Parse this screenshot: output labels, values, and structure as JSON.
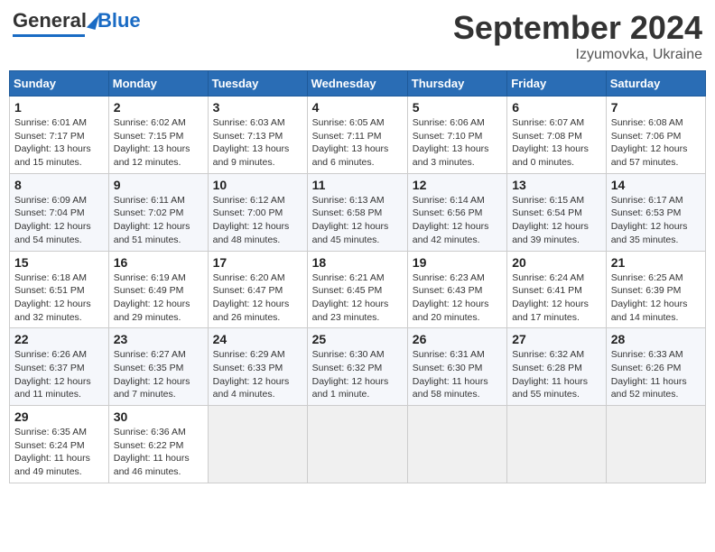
{
  "header": {
    "logo_general": "General",
    "logo_blue": "Blue",
    "month_title": "September 2024",
    "location": "Izyumovka, Ukraine"
  },
  "weekdays": [
    "Sunday",
    "Monday",
    "Tuesday",
    "Wednesday",
    "Thursday",
    "Friday",
    "Saturday"
  ],
  "weeks": [
    [
      {
        "day": "1",
        "info": "Sunrise: 6:01 AM\nSunset: 7:17 PM\nDaylight: 13 hours\nand 15 minutes."
      },
      {
        "day": "2",
        "info": "Sunrise: 6:02 AM\nSunset: 7:15 PM\nDaylight: 13 hours\nand 12 minutes."
      },
      {
        "day": "3",
        "info": "Sunrise: 6:03 AM\nSunset: 7:13 PM\nDaylight: 13 hours\nand 9 minutes."
      },
      {
        "day": "4",
        "info": "Sunrise: 6:05 AM\nSunset: 7:11 PM\nDaylight: 13 hours\nand 6 minutes."
      },
      {
        "day": "5",
        "info": "Sunrise: 6:06 AM\nSunset: 7:10 PM\nDaylight: 13 hours\nand 3 minutes."
      },
      {
        "day": "6",
        "info": "Sunrise: 6:07 AM\nSunset: 7:08 PM\nDaylight: 13 hours\nand 0 minutes."
      },
      {
        "day": "7",
        "info": "Sunrise: 6:08 AM\nSunset: 7:06 PM\nDaylight: 12 hours\nand 57 minutes."
      }
    ],
    [
      {
        "day": "8",
        "info": "Sunrise: 6:09 AM\nSunset: 7:04 PM\nDaylight: 12 hours\nand 54 minutes."
      },
      {
        "day": "9",
        "info": "Sunrise: 6:11 AM\nSunset: 7:02 PM\nDaylight: 12 hours\nand 51 minutes."
      },
      {
        "day": "10",
        "info": "Sunrise: 6:12 AM\nSunset: 7:00 PM\nDaylight: 12 hours\nand 48 minutes."
      },
      {
        "day": "11",
        "info": "Sunrise: 6:13 AM\nSunset: 6:58 PM\nDaylight: 12 hours\nand 45 minutes."
      },
      {
        "day": "12",
        "info": "Sunrise: 6:14 AM\nSunset: 6:56 PM\nDaylight: 12 hours\nand 42 minutes."
      },
      {
        "day": "13",
        "info": "Sunrise: 6:15 AM\nSunset: 6:54 PM\nDaylight: 12 hours\nand 39 minutes."
      },
      {
        "day": "14",
        "info": "Sunrise: 6:17 AM\nSunset: 6:53 PM\nDaylight: 12 hours\nand 35 minutes."
      }
    ],
    [
      {
        "day": "15",
        "info": "Sunrise: 6:18 AM\nSunset: 6:51 PM\nDaylight: 12 hours\nand 32 minutes."
      },
      {
        "day": "16",
        "info": "Sunrise: 6:19 AM\nSunset: 6:49 PM\nDaylight: 12 hours\nand 29 minutes."
      },
      {
        "day": "17",
        "info": "Sunrise: 6:20 AM\nSunset: 6:47 PM\nDaylight: 12 hours\nand 26 minutes."
      },
      {
        "day": "18",
        "info": "Sunrise: 6:21 AM\nSunset: 6:45 PM\nDaylight: 12 hours\nand 23 minutes."
      },
      {
        "day": "19",
        "info": "Sunrise: 6:23 AM\nSunset: 6:43 PM\nDaylight: 12 hours\nand 20 minutes."
      },
      {
        "day": "20",
        "info": "Sunrise: 6:24 AM\nSunset: 6:41 PM\nDaylight: 12 hours\nand 17 minutes."
      },
      {
        "day": "21",
        "info": "Sunrise: 6:25 AM\nSunset: 6:39 PM\nDaylight: 12 hours\nand 14 minutes."
      }
    ],
    [
      {
        "day": "22",
        "info": "Sunrise: 6:26 AM\nSunset: 6:37 PM\nDaylight: 12 hours\nand 11 minutes."
      },
      {
        "day": "23",
        "info": "Sunrise: 6:27 AM\nSunset: 6:35 PM\nDaylight: 12 hours\nand 7 minutes."
      },
      {
        "day": "24",
        "info": "Sunrise: 6:29 AM\nSunset: 6:33 PM\nDaylight: 12 hours\nand 4 minutes."
      },
      {
        "day": "25",
        "info": "Sunrise: 6:30 AM\nSunset: 6:32 PM\nDaylight: 12 hours\nand 1 minute."
      },
      {
        "day": "26",
        "info": "Sunrise: 6:31 AM\nSunset: 6:30 PM\nDaylight: 11 hours\nand 58 minutes."
      },
      {
        "day": "27",
        "info": "Sunrise: 6:32 AM\nSunset: 6:28 PM\nDaylight: 11 hours\nand 55 minutes."
      },
      {
        "day": "28",
        "info": "Sunrise: 6:33 AM\nSunset: 6:26 PM\nDaylight: 11 hours\nand 52 minutes."
      }
    ],
    [
      {
        "day": "29",
        "info": "Sunrise: 6:35 AM\nSunset: 6:24 PM\nDaylight: 11 hours\nand 49 minutes."
      },
      {
        "day": "30",
        "info": "Sunrise: 6:36 AM\nSunset: 6:22 PM\nDaylight: 11 hours\nand 46 minutes."
      },
      {
        "day": "",
        "info": ""
      },
      {
        "day": "",
        "info": ""
      },
      {
        "day": "",
        "info": ""
      },
      {
        "day": "",
        "info": ""
      },
      {
        "day": "",
        "info": ""
      }
    ]
  ]
}
